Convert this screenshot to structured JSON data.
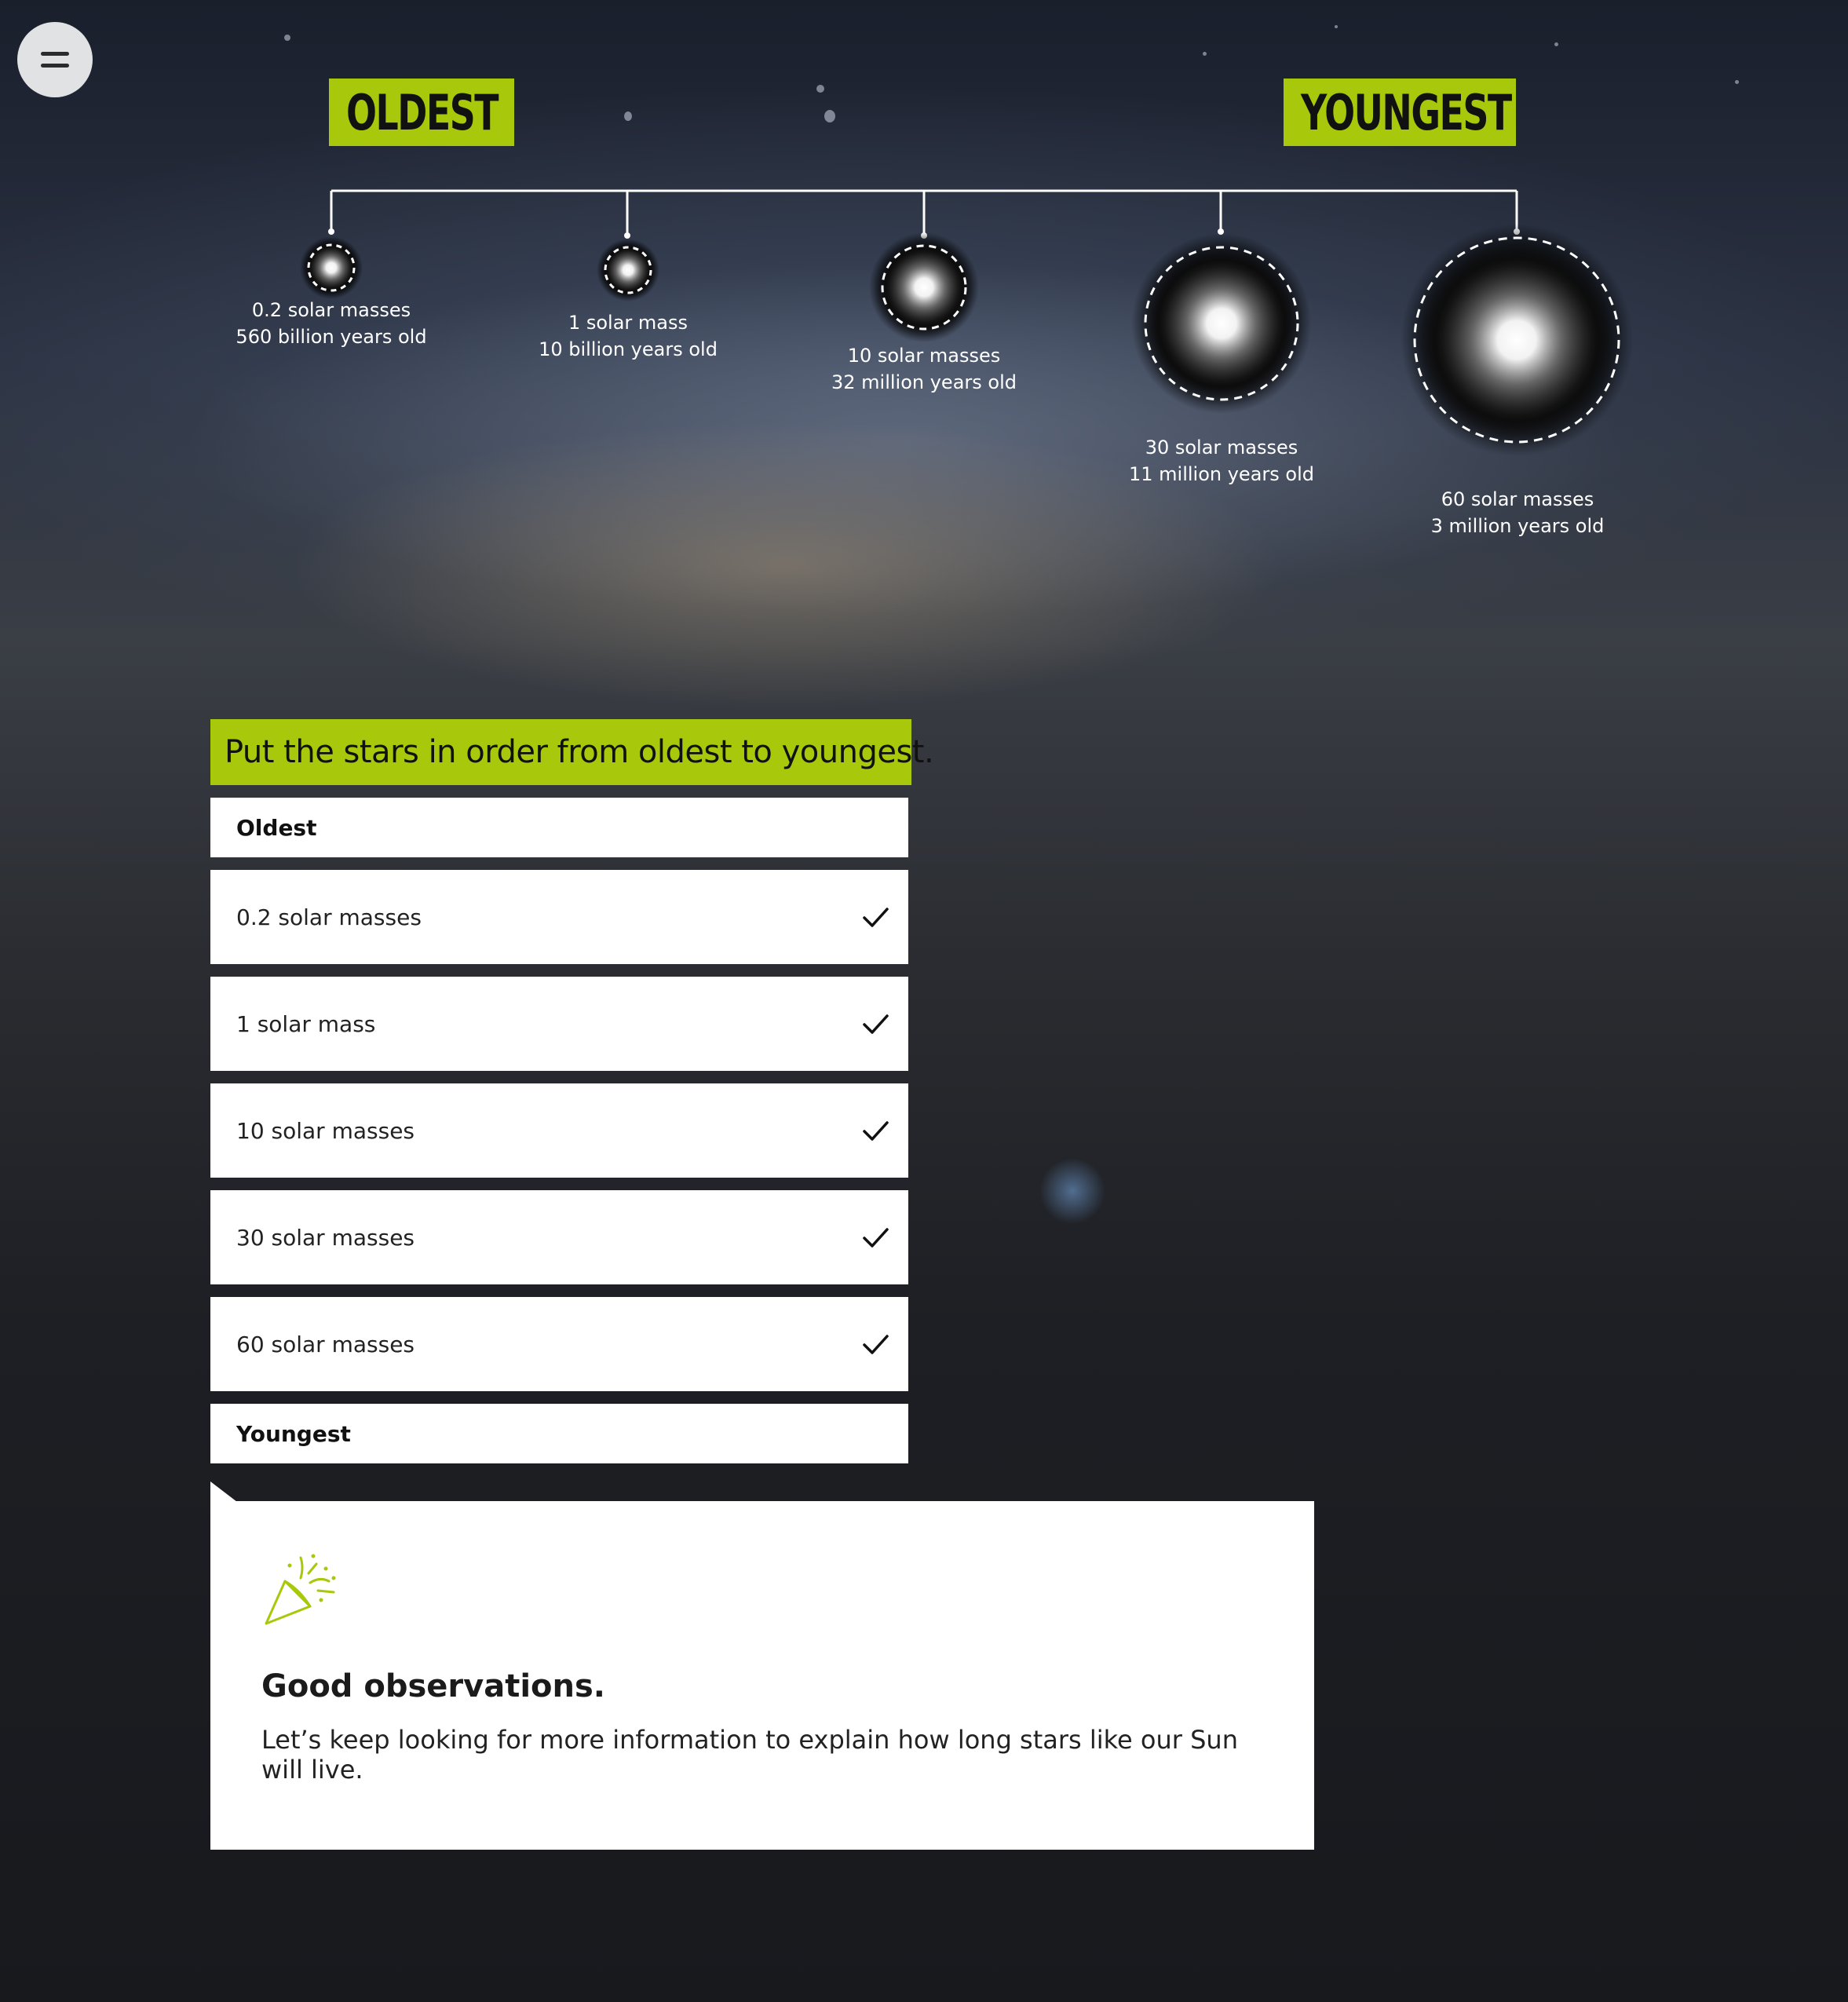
{
  "menu": {
    "icon": "hamburger-menu-icon"
  },
  "timeline": {
    "oldest_label": "OLDEST",
    "youngest_label": "YOUNGEST",
    "accent_color": "#a8c80c",
    "stars": [
      {
        "mass": "0.2 solar masses",
        "age": "560 billion years old"
      },
      {
        "mass": "1 solar mass",
        "age": "10 billion years old"
      },
      {
        "mass": "10 solar masses",
        "age": "32 million years old"
      },
      {
        "mass": "30 solar masses",
        "age": "11 million years old"
      },
      {
        "mass": "60 solar masses",
        "age": "3 million years old"
      }
    ]
  },
  "task": {
    "prompt": "Put the stars in order from oldest to youngest.",
    "top_label": "Oldest",
    "bottom_label": "Youngest",
    "items": [
      {
        "label": "0.2 solar masses",
        "status": "correct"
      },
      {
        "label": "1 solar mass",
        "status": "correct"
      },
      {
        "label": "10 solar masses",
        "status": "correct"
      },
      {
        "label": "30 solar masses",
        "status": "correct"
      },
      {
        "label": "60 solar masses",
        "status": "correct"
      }
    ]
  },
  "feedback": {
    "icon": "party-popper-icon",
    "title": "Good observations.",
    "body": "Let’s keep looking for more information to explain how long stars like our Sun will live."
  }
}
